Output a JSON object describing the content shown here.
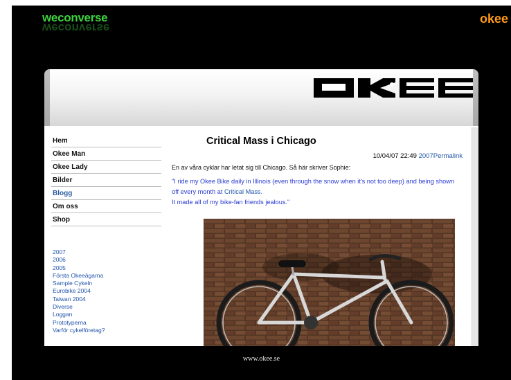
{
  "header": {
    "brand": "weconverse",
    "corner": "okee"
  },
  "logo": {
    "text": "OKEE"
  },
  "nav": {
    "items": [
      "Hem",
      "Okee Man",
      "Okee Lady",
      "Bilder",
      "Blogg",
      "Om oss",
      "Shop"
    ],
    "active": "Blogg"
  },
  "archive": {
    "items": [
      "2007",
      "2006",
      "2005",
      "Första Okeeägarna",
      "Sample Cykeln",
      "Eurobike 2004",
      "Taiwan 2004",
      "Diverse",
      "Loggan",
      "Prototyperna",
      "Varför cykelföretag?"
    ]
  },
  "post": {
    "title": "Critical Mass i Chicago",
    "date": "10/04/07 22:49",
    "year_link": "2007",
    "permalink": "Permalink",
    "intro": "En av våra cyklar har letat sig till Chicago. Så här skriver Sophie:",
    "quote_part1": "\"I ride my Okee Bike daily in Illinois (even through the snow when it's not too deep) and being shown off every month at",
    "quote_link": "Critical Mass",
    "quote_end": ".",
    "quote_part2": "It made all of my bike-fan friends jealous.\""
  },
  "footer": {
    "url": "www.okee.se"
  },
  "colors": {
    "brand_green": "#3fd23f",
    "corner_orange": "#ff9a1a",
    "link_blue": "#2255aa",
    "quote_blue": "#2a3bd1",
    "background": "#000000"
  }
}
